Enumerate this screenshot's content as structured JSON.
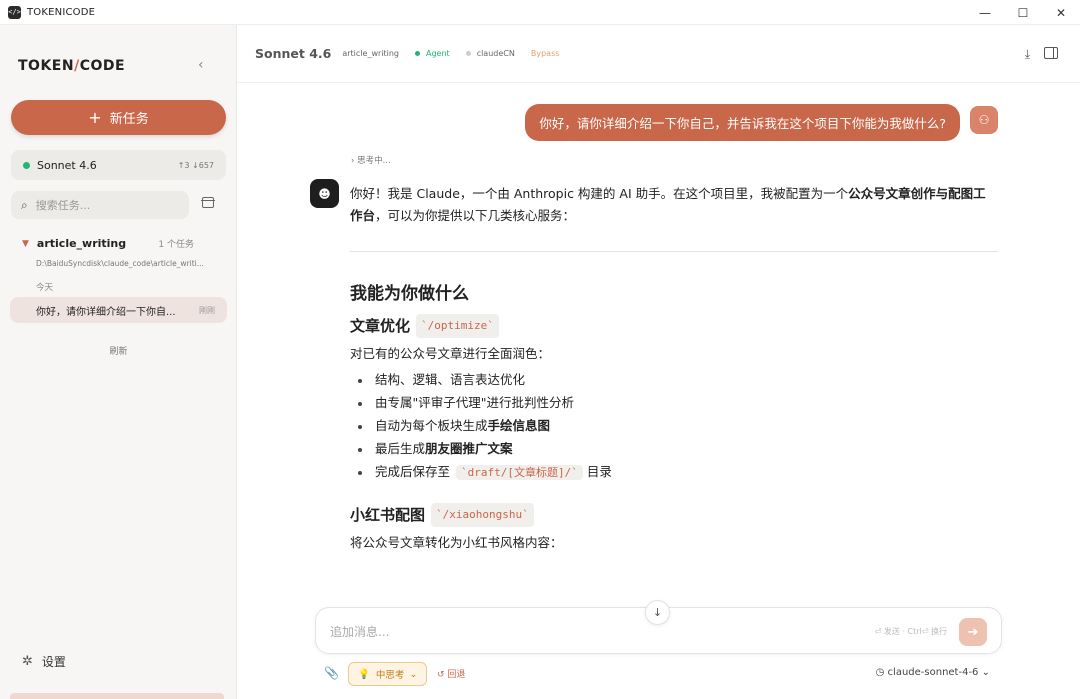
{
  "window": {
    "title": "TOKENICODE",
    "icon_glyph": "</>"
  },
  "sidebar": {
    "logo_left": "TOKEN",
    "logo_slash": "/",
    "logo_right": "CODE",
    "new_task_label": "新任务",
    "model_name": "Sonnet 4.6",
    "model_tokens": "↑3 ↓657",
    "search_placeholder": "搜索任务...",
    "project": {
      "name": "article_writing",
      "count": "1 个任务",
      "path": "D:\\BaiduSyncdisk\\claude_code\\article_writi..."
    },
    "date_group": "今天",
    "session": {
      "title": "你好，请你详细介绍一下你自...",
      "time": "刚刚"
    },
    "refresh_label": "刷新",
    "settings_label": "设置"
  },
  "header": {
    "model": "Sonnet 4.6",
    "project": "article_writing",
    "tags": [
      {
        "label": "Agent",
        "color": "#22b573",
        "dot": "#22b573"
      },
      {
        "label": "claudeCN",
        "color": "#666666",
        "dot": "#cccccc"
      },
      {
        "label": "Bypass",
        "color": "#e8a06a",
        "dot": "transparent"
      }
    ]
  },
  "chat": {
    "user_message": "你好，请你详细介绍一下你自己，并告诉我在这个项目下你能为我做什么?",
    "thinking_label": "思考中...",
    "intro_1": "你好！我是 Claude，一个由 Anthropic 构建的 AI 助手。在这个项目里，我被配置为一个",
    "intro_bold": "公众号文章创作与配图工作台",
    "intro_2": "，可以为你提供以下几类核心服务：",
    "section_title": "我能为你做什么",
    "s1": {
      "title": "文章优化",
      "code": "`/optimize`",
      "desc": "对已有的公众号文章进行全面润色：",
      "item1": "结构、逻辑、语言表达优化",
      "item2": "由专属\"评审子代理\"进行批判性分析",
      "item3_pre": "自动为每个板块生成",
      "item3_bold": "手绘信息图",
      "item4_pre": "最后生成",
      "item4_bold": "朋友圈推广文案",
      "item5_pre": "完成后保存至",
      "item5_code": "`draft/[文章标题]/`",
      "item5_post": "目录"
    },
    "s2": {
      "title": "小红书配图",
      "code": "`/xiaohongshu`",
      "desc": "将公众号文章转化为小红书风格内容："
    }
  },
  "composer": {
    "placeholder": "追加消息...",
    "hint": "⏎ 发送 · Ctrl⏎ 换行",
    "thinking_mode": "中思考",
    "rollback_label": "回退",
    "model_select": "claude-sonnet-4-6"
  },
  "colors": {
    "accent": "#c9674a",
    "agent": "#22b573"
  }
}
